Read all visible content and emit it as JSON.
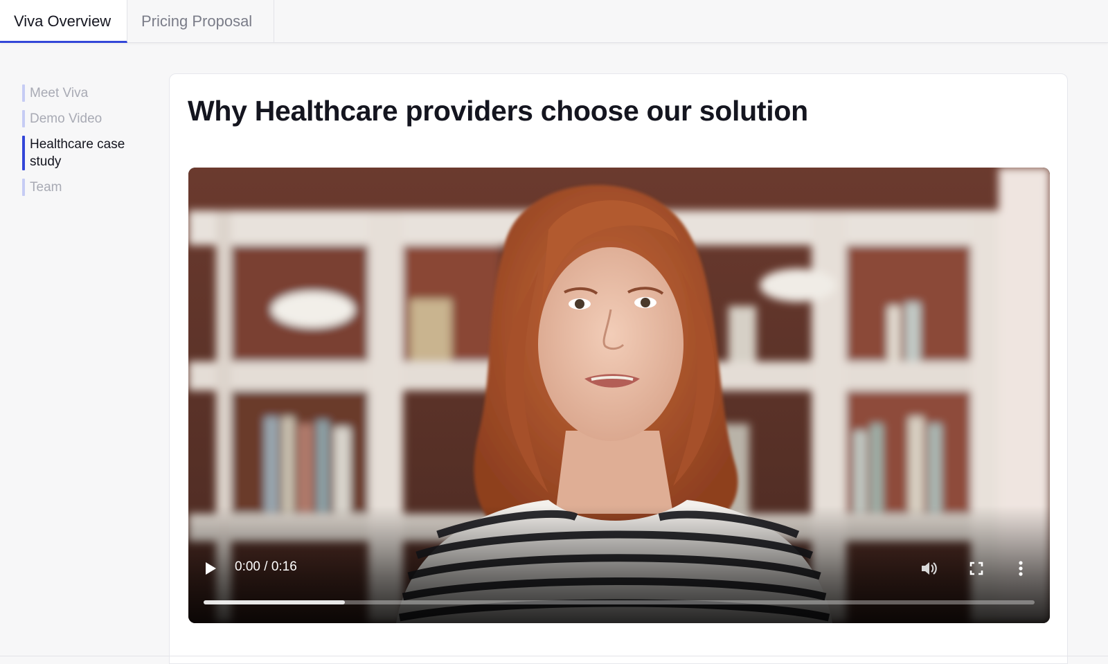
{
  "tabs": [
    {
      "label": "Viva Overview",
      "active": true
    },
    {
      "label": "Pricing Proposal",
      "active": false
    }
  ],
  "sidebar": {
    "items": [
      {
        "label": "Meet Viva",
        "active": false
      },
      {
        "label": "Demo Video",
        "active": false
      },
      {
        "label": "Healthcare case study",
        "active": true
      },
      {
        "label": "Team",
        "active": false
      }
    ]
  },
  "main": {
    "title": "Why Healthcare providers choose our solution",
    "video": {
      "time_display": "0:00 / 0:16",
      "buffered_fraction": 0.17,
      "icons": [
        "play-icon",
        "volume-icon",
        "fullscreen-icon",
        "more-vert-icon"
      ]
    }
  },
  "colors": {
    "accent": "#3346d8",
    "accent_light": "#c6ccf4",
    "background": "#f7f7f8",
    "card": "#ffffff"
  }
}
